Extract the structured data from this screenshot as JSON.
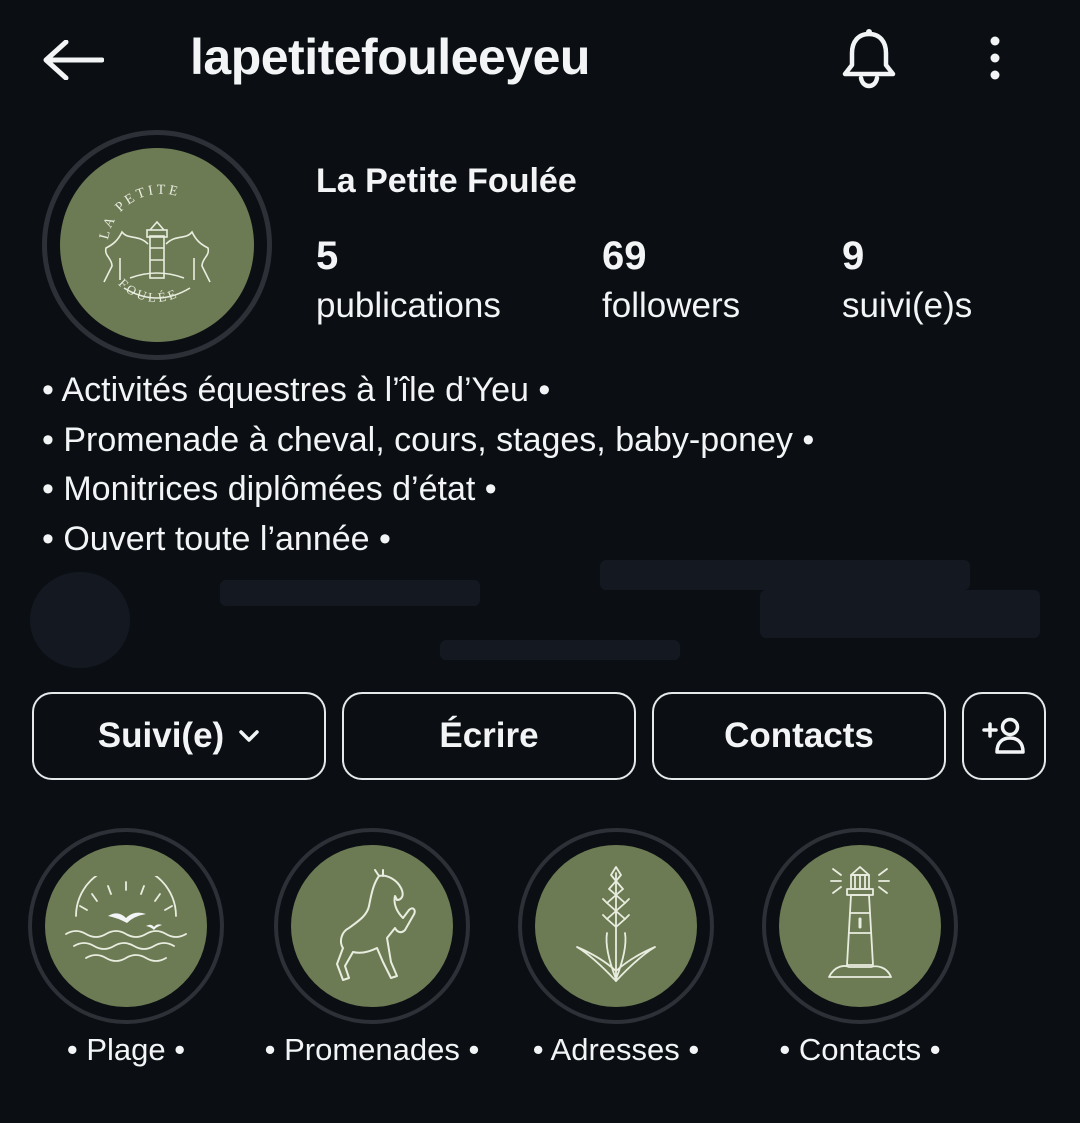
{
  "header": {
    "username": "lapetitefouleeyeu",
    "back_icon": "arrow-left-icon",
    "bell_icon": "bell-icon",
    "more_icon": "more-vertical-icon"
  },
  "profile": {
    "display_name": "La Petite Foulée",
    "avatar_text_top": "LA PETITE",
    "avatar_text_bottom": "FOULÉE",
    "stats": {
      "posts": {
        "value": "5",
        "label": "publications"
      },
      "followers": {
        "value": "69",
        "label": "followers"
      },
      "following": {
        "value": "9",
        "label": "suivi(e)s"
      }
    },
    "bio": [
      "• Activités équestres à l’île d’Yeu •",
      "• Promenade à cheval, cours, stages, baby-poney •",
      "• Monitrices diplômées d’état •",
      "• Ouvert toute l’année •"
    ]
  },
  "actions": {
    "follow_label": "Suivi(e)",
    "message_label": "Écrire",
    "contacts_label": "Contacts",
    "add_user_icon": "add-user-icon"
  },
  "highlights": [
    {
      "label": "• Plage •",
      "icon": "beach-icon"
    },
    {
      "label": "• Promenades •",
      "icon": "horse-icon"
    },
    {
      "label": "• Adresses •",
      "icon": "flower-icon"
    },
    {
      "label": "• Contacts •",
      "icon": "lighthouse-icon"
    }
  ],
  "colors": {
    "background": "#0b0f14",
    "text": "#f2f4f5",
    "brand_green": "#6c7b53",
    "ring": "#2d3036"
  }
}
